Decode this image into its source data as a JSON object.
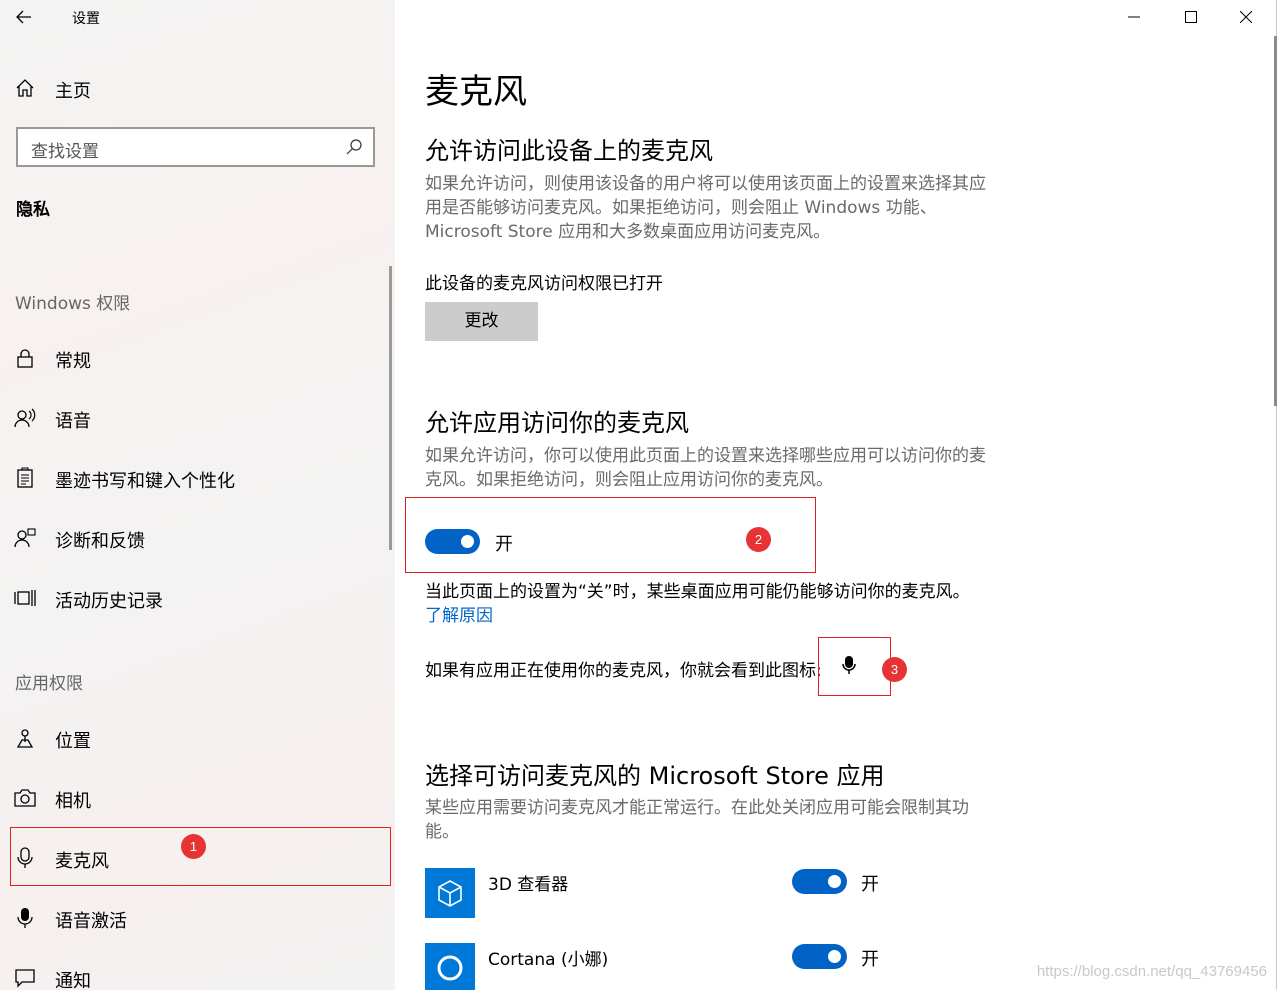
{
  "window": {
    "title": "设置",
    "back_glyph": "←",
    "minimize_icon": "minimize-icon",
    "maximize_icon": "maximize-icon",
    "close_icon": "close-icon"
  },
  "sidebar": {
    "home": {
      "label": "主页",
      "icon": "home-icon"
    },
    "search": {
      "placeholder": "查找设置",
      "icon": "search-icon"
    },
    "section": "隐私",
    "groups": [
      {
        "label": "Windows 权限",
        "items": [
          {
            "label": "常规",
            "icon": "lock-icon"
          },
          {
            "label": "语音",
            "icon": "speech-icon"
          },
          {
            "label": "墨迹书写和键入个性化",
            "icon": "inking-icon"
          },
          {
            "label": "诊断和反馈",
            "icon": "feedback-icon"
          },
          {
            "label": "活动历史记录",
            "icon": "timeline-icon"
          }
        ]
      },
      {
        "label": "应用权限",
        "items": [
          {
            "label": "位置",
            "icon": "location-icon"
          },
          {
            "label": "相机",
            "icon": "camera-icon"
          },
          {
            "label": "麦克风",
            "icon": "microphone-icon",
            "selected": true
          },
          {
            "label": "语音激活",
            "icon": "voice-activation-icon"
          },
          {
            "label": "通知",
            "icon": "notification-icon"
          }
        ]
      }
    ]
  },
  "main": {
    "title": "麦克风",
    "device_access": {
      "heading": "允许访问此设备上的麦克风",
      "description": "如果允许访问，则使用该设备的用户将可以使用该页面上的设置来选择其应用是否能够访问麦克风。如果拒绝访问，则会阻止 Windows 功能、Microsoft Store 应用和大多数桌面应用访问麦克风。",
      "status": "此设备的麦克风访问权限已打开",
      "change_button": "更改"
    },
    "app_access": {
      "heading": "允许应用访问你的麦克风",
      "description": "如果允许访问，你可以使用此页面上的设置来选择哪些应用可以访问你的麦克风。如果拒绝访问，则会阻止应用访问你的麦克风。",
      "toggle_state": "开",
      "toggle_on": true,
      "note": "当此页面上的设置为“关”时，某些桌面应用可能仍能够访问你的麦克风。",
      "learn_more": "了解原因",
      "icon_hint": "如果有应用正在使用你的麦克风，你就会看到此图标:"
    },
    "store_apps": {
      "heading": "选择可访问麦克风的 Microsoft Store 应用",
      "description": "某些应用需要访问麦克风才能正常运行。在此处关闭应用可能会限制其功能。",
      "apps": [
        {
          "name": "3D 查看器",
          "state": "开",
          "on": true,
          "icon": "3d-viewer-icon"
        },
        {
          "name": "Cortana (小娜)",
          "state": "开",
          "on": true,
          "icon": "cortana-icon"
        }
      ]
    }
  },
  "annotations": [
    "1",
    "2",
    "3"
  ],
  "watermark": "https://blog.csdn.net/qq_43769456",
  "colors": {
    "accent": "#0063c5",
    "annotation": "#e02020",
    "link": "#0066cc"
  }
}
